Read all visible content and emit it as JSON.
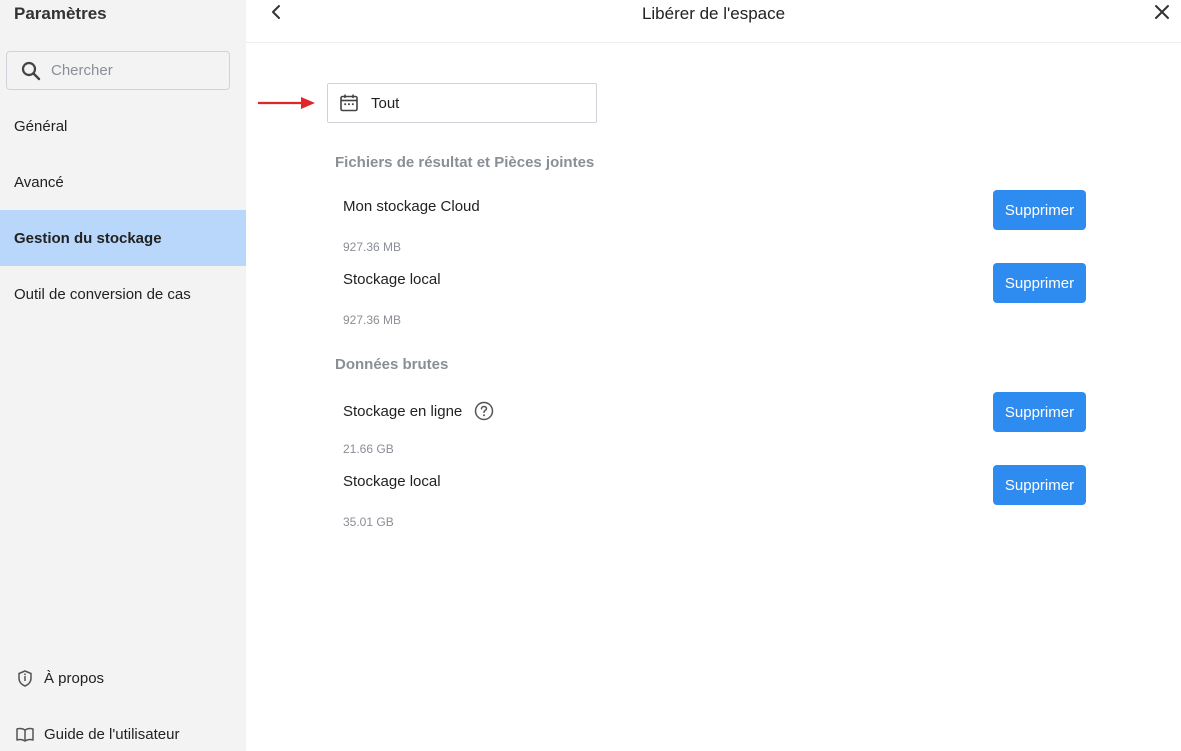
{
  "sidebar": {
    "title": "Paramètres",
    "search": {
      "placeholder": "Chercher",
      "icon": "search-icon"
    },
    "items": [
      {
        "label": "Général",
        "active": false
      },
      {
        "label": "Avancé",
        "active": false
      },
      {
        "label": "Gestion du stockage",
        "active": true
      },
      {
        "label": "Outil de conversion de cas",
        "active": false
      }
    ],
    "bottom": [
      {
        "label": "À propos",
        "icon": "shield-icon"
      },
      {
        "label": "Guide de l'utilisateur",
        "icon": "book-icon"
      }
    ]
  },
  "header": {
    "title": "Libérer de l'espace",
    "back_icon": "chevron-left-icon",
    "close_icon": "close-icon"
  },
  "filter": {
    "value": "Tout",
    "icon": "calendar-icon"
  },
  "sections": [
    {
      "title": "Fichiers de résultat et Pièces jointes",
      "rows": [
        {
          "name": "Mon stockage Cloud",
          "size": "927.36 MB",
          "button": "Supprimer"
        },
        {
          "name": "Stockage local",
          "size": "927.36 MB",
          "button": "Supprimer"
        }
      ]
    },
    {
      "title": "Données brutes",
      "rows": [
        {
          "name": "Stockage en ligne",
          "size": "21.66 GB",
          "button": "Supprimer",
          "help_icon": "help-circle-icon"
        },
        {
          "name": "Stockage local",
          "size": "35.01 GB",
          "button": "Supprimer"
        }
      ]
    }
  ],
  "colors": {
    "accent": "#2e8cf0",
    "active_nav": "#b9d7fa",
    "arrow": "#e0262b",
    "sidebar_bg": "#f3f3f3"
  }
}
